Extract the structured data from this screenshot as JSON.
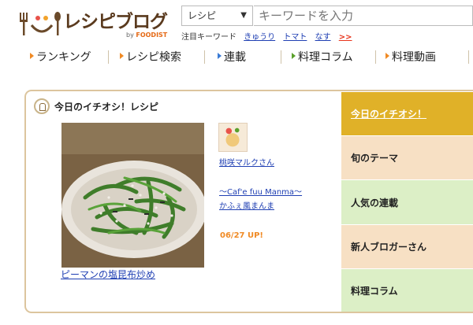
{
  "header": {
    "logo_text": "レシピブログ",
    "logo_sub_prefix": "by ",
    "logo_sub_brand": "FOODIST",
    "search": {
      "category_selected": "レシピ",
      "placeholder": "キーワードを入力"
    },
    "hot_keywords": {
      "label": "注目キーワード",
      "items": [
        "きゅうり",
        "トマト",
        "なす"
      ],
      "more_label": ">>"
    }
  },
  "nav": {
    "items": [
      {
        "label": "ランキング",
        "icon": "triangle-right-icon",
        "color": "#f08a24"
      },
      {
        "label": "レシピ検索",
        "icon": "triangle-right-icon",
        "color": "#f08a24"
      },
      {
        "label": "連載",
        "icon": "triangle-right-icon",
        "color": "#3a7bd5"
      },
      {
        "label": "料理コラム",
        "icon": "triangle-right-icon",
        "color": "#5aa02c"
      },
      {
        "label": "料理動画",
        "icon": "triangle-right-icon",
        "color": "#f08a24"
      }
    ]
  },
  "featured": {
    "title": "今日のイチオシ！レシピ",
    "recipe_name": "ピーマンの塩昆布炒め",
    "author_name": "桃咲マルクさん",
    "blog_name_line1": "～Caf'e fuu Manma～",
    "blog_name_line2": "かふぇ風まんま",
    "update_date": "06/27 UP!"
  },
  "tabs": [
    {
      "label": "今日のイチオシ！",
      "active": true,
      "color": "#e0b128"
    },
    {
      "label": "旬のテーマ",
      "active": false,
      "color": "#f7e0c4"
    },
    {
      "label": "人気の連載",
      "active": false,
      "color": "#dcefc6"
    },
    {
      "label": "新人ブロガーさん",
      "active": false,
      "color": "#f7e0c4"
    },
    {
      "label": "料理コラム",
      "active": false,
      "color": "#dcefc6"
    }
  ],
  "colors": {
    "accent": "#e0b128",
    "link": "#1f3fb3",
    "panel_border": "#dcc59e",
    "date": "#f08a24"
  }
}
